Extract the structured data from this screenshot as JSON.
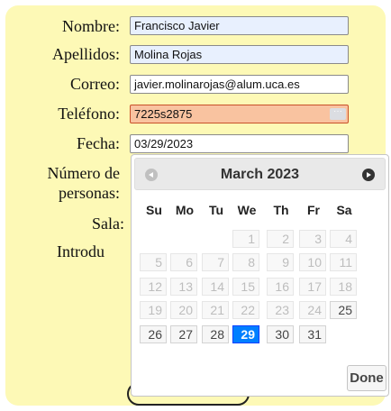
{
  "form": {
    "nombre_label": "Nombre:",
    "nombre_value": "Francisco Javier",
    "apellidos_label": "Apellidos:",
    "apellidos_value": "Molina Rojas",
    "correo_label": "Correo:",
    "correo_value": "javier.molinarojas@alum.uca.es",
    "telefono_label": "Teléfono:",
    "telefono_value": "7225s2875",
    "fecha_label": "Fecha:",
    "fecha_value": "03/29/2023",
    "personas_label_1": "Número de",
    "personas_label_2": "personas:",
    "sala_label": "Sala:",
    "introduce_label": "Introdu",
    "more_icon": "···"
  },
  "datepicker": {
    "title": "March 2023",
    "weekdays": [
      "Su",
      "Mo",
      "Tu",
      "We",
      "Th",
      "Fr",
      "Sa"
    ],
    "weeks": [
      [
        "",
        "",
        "",
        "1",
        "2",
        "3",
        "4"
      ],
      [
        "5",
        "6",
        "7",
        "8",
        "9",
        "10",
        "11"
      ],
      [
        "12",
        "13",
        "14",
        "15",
        "16",
        "17",
        "18"
      ],
      [
        "19",
        "20",
        "21",
        "22",
        "23",
        "24",
        "25"
      ],
      [
        "26",
        "27",
        "28",
        "29",
        "30",
        "31",
        ""
      ]
    ],
    "selected_day": "29",
    "done_label": "Done"
  },
  "colors": {
    "card_bg": "#fdf9b6",
    "error_bg": "#f9c3a0",
    "selected": "#007fff"
  }
}
